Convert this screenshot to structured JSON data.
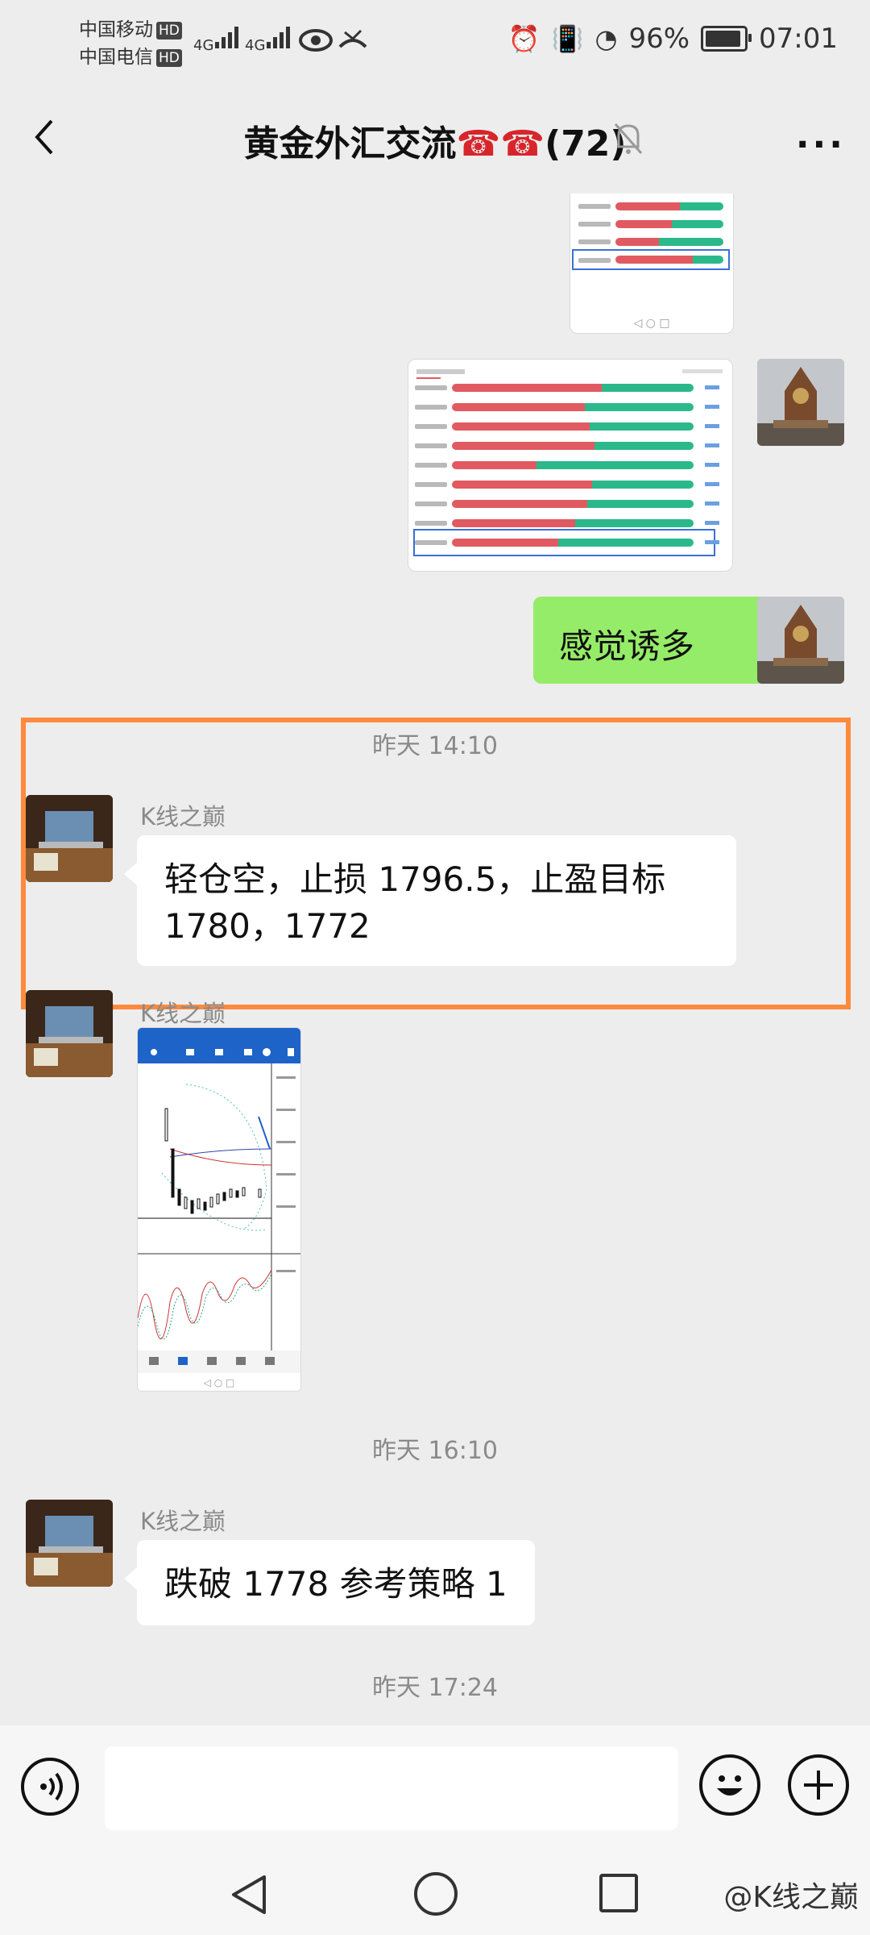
{
  "status": {
    "carrier1": "中国移动",
    "carrier2": "中国电信",
    "hd": "HD",
    "net1": "4G",
    "net2": "4G",
    "battery": "96%",
    "time": "07:01"
  },
  "header": {
    "title": "黄金外汇交流",
    "phones": "☎☎",
    "count": "(72)"
  },
  "messages": {
    "sent_text": "感觉诱多",
    "time1": "昨天 14:10",
    "sender1": "K线之巅",
    "msg1_line1": "轻仓空，止损 1796.5，止盈目标",
    "msg1_line2": "1780，1772",
    "sender2": "K线之巅",
    "time2": "昨天 16:10",
    "sender3": "K线之巅",
    "msg3": "跌破 1778 参考策略 1",
    "time3": "昨天 17:24"
  },
  "thumb_bars": [
    {
      "red": 0.62,
      "green": 0.38
    },
    {
      "red": 0.55,
      "green": 0.45
    },
    {
      "red": 0.57,
      "green": 0.43
    },
    {
      "red": 0.59,
      "green": 0.41
    },
    {
      "red": 0.35,
      "green": 0.65
    },
    {
      "red": 0.58,
      "green": 0.42
    },
    {
      "red": 0.56,
      "green": 0.44
    },
    {
      "red": 0.51,
      "green": 0.49
    },
    {
      "red": 0.44,
      "green": 0.56
    }
  ],
  "nav": {
    "watermark": "@K线之巅"
  }
}
